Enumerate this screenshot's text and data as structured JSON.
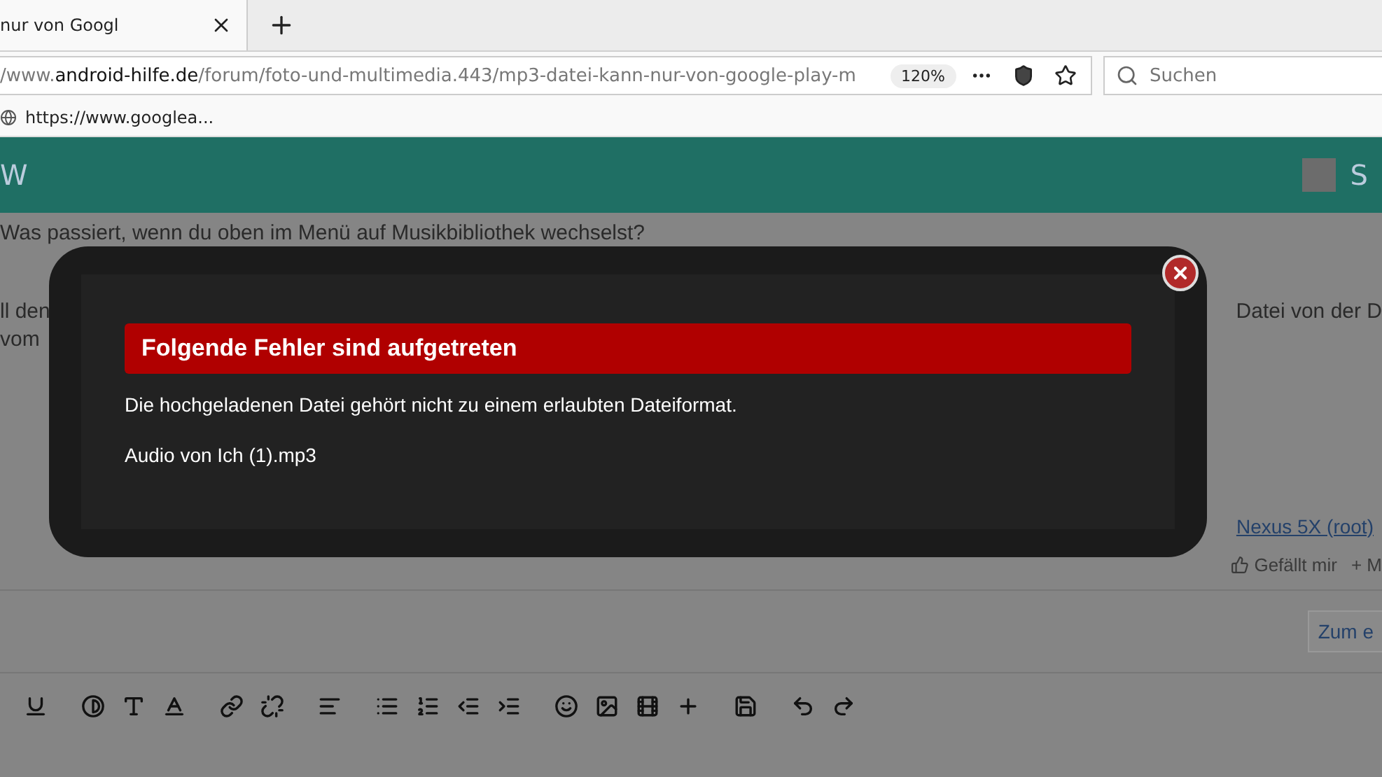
{
  "browser": {
    "tab": {
      "title": "nur von Googl"
    },
    "address": {
      "host_prefix": "/www.",
      "host": "android-hilfe.de",
      "path": "/forum/foto-und-multimedia.443/mp3-datei-kann-nur-von-google-play-m",
      "zoom": "120%"
    },
    "search": {
      "placeholder": "Suchen"
    },
    "status_url": "https://www.googlea..."
  },
  "site_header": {
    "logo_fragment": "W",
    "user_fragment": "S"
  },
  "post": {
    "line_1": "Was passiert, wenn du oben im Menü auf Musikbibliothek wechselst?",
    "line_2_left": "ll den",
    "line_2_right": "Datei von der D",
    "line_3_left": "vom",
    "device_link": "Nexus 5X (root)",
    "like": "Gefällt mir",
    "more": "+ M",
    "jump_button": "Zum e"
  },
  "editor_toolbar": [
    {
      "kind": "underline"
    },
    {
      "kind": "contrast"
    },
    {
      "kind": "text-size"
    },
    {
      "kind": "font"
    },
    {
      "kind": "link"
    },
    {
      "kind": "unlink"
    },
    {
      "kind": "align"
    },
    {
      "kind": "bullets"
    },
    {
      "kind": "numbers"
    },
    {
      "kind": "outdent"
    },
    {
      "kind": "indent"
    },
    {
      "kind": "smiley"
    },
    {
      "kind": "image"
    },
    {
      "kind": "film"
    },
    {
      "kind": "plus"
    },
    {
      "kind": "save"
    },
    {
      "kind": "undo"
    },
    {
      "kind": "redo"
    }
  ],
  "error_dialog": {
    "title": "Folgende Fehler sind aufgetreten",
    "message": "Die hochgeladenen Datei gehört nicht zu einem erlaubten Dateiformat.",
    "file": "Audio von Ich (1).mp3"
  }
}
